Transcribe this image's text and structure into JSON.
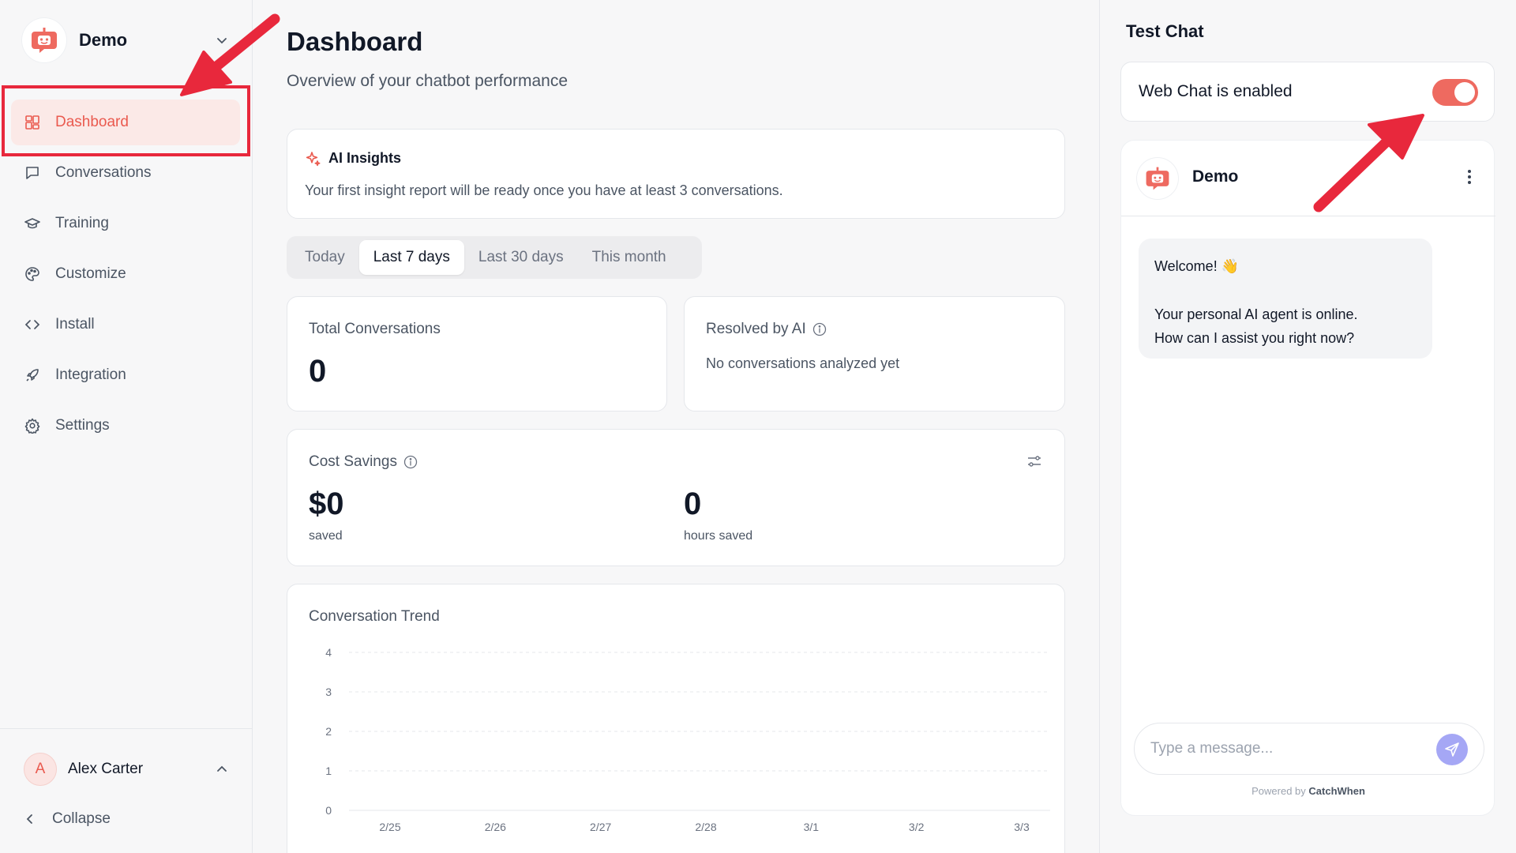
{
  "sidebar": {
    "workspace_name": "Demo",
    "items": [
      {
        "label": "Dashboard",
        "icon": "dashboard-icon"
      },
      {
        "label": "Conversations",
        "icon": "chat-icon"
      },
      {
        "label": "Training",
        "icon": "graduation-cap-icon"
      },
      {
        "label": "Customize",
        "icon": "palette-icon"
      },
      {
        "label": "Install",
        "icon": "code-icon"
      },
      {
        "label": "Integration",
        "icon": "rocket-icon"
      },
      {
        "label": "Settings",
        "icon": "gear-icon"
      }
    ],
    "active_item": "Dashboard",
    "user": {
      "initial": "A",
      "name": "Alex Carter"
    },
    "collapse_label": "Collapse"
  },
  "main": {
    "title": "Dashboard",
    "subtitle": "Overview of your chatbot performance",
    "insights": {
      "title": "AI Insights",
      "text": "Your first insight report will be ready once you have at least 3 conversations."
    },
    "tabs": [
      "Today",
      "Last 7 days",
      "Last 30 days",
      "This month"
    ],
    "active_tab": "Last 7 days",
    "stats": {
      "total_conversations": {
        "label": "Total Conversations",
        "value": "0"
      },
      "resolved_by_ai": {
        "label": "Resolved by AI",
        "note": "No conversations analyzed yet"
      }
    },
    "cost_savings": {
      "label": "Cost Savings",
      "money_value": "$0",
      "money_sub": "saved",
      "hours_value": "0",
      "hours_sub": "hours saved"
    }
  },
  "chart_data": {
    "type": "line",
    "title": "Conversation Trend",
    "categories": [
      "2/25",
      "2/26",
      "2/27",
      "2/28",
      "3/1",
      "3/2",
      "3/3"
    ],
    "values": [
      0,
      0,
      0,
      0,
      0,
      0,
      0
    ],
    "yticks": [
      0,
      1,
      2,
      3,
      4
    ],
    "ylim": [
      0,
      4
    ],
    "grid": true
  },
  "right_panel": {
    "title": "Test Chat",
    "toggle_label": "Web Chat is enabled",
    "toggle_on": true,
    "chat": {
      "bot_name": "Demo",
      "welcome_line1": "Welcome! 👋",
      "welcome_line2": "Your personal AI agent is online.",
      "welcome_line3": "How can I assist you right now?",
      "input_placeholder": "Type a message...",
      "powered_by_prefix": "Powered by",
      "powered_by_brand": "CatchWhen"
    }
  },
  "colors": {
    "accent": "#ea5a4f",
    "annotation": "#e8283c",
    "send_button": "#a5a7f5"
  }
}
